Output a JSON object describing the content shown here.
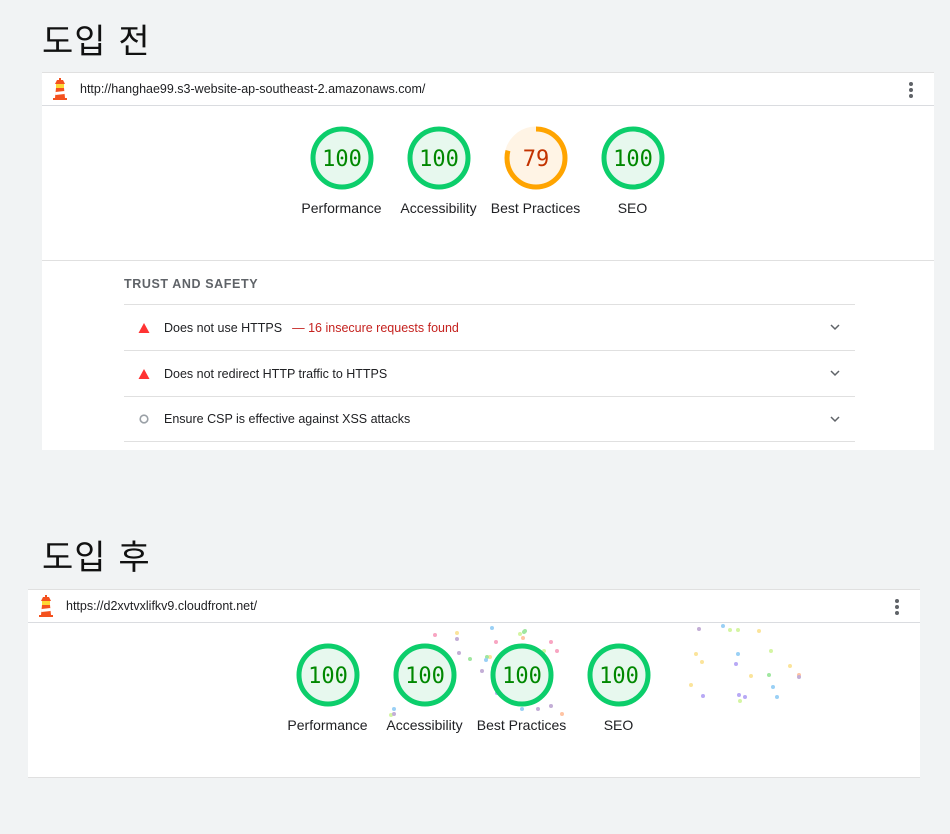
{
  "before": {
    "heading": "도입 전",
    "url": "http://hanghae99.s3-website-ap-southeast-2.amazonaws.com/",
    "gauges": [
      {
        "score": "100",
        "label": "Performance",
        "value": 100,
        "status": "pass"
      },
      {
        "score": "100",
        "label": "Accessibility",
        "value": 100,
        "status": "pass"
      },
      {
        "score": "79",
        "label": "Best Practices",
        "value": 79,
        "status": "average"
      },
      {
        "score": "100",
        "label": "SEO",
        "value": 100,
        "status": "pass"
      }
    ],
    "section_title": "TRUST AND SAFETY",
    "audits": [
      {
        "title": "Does not use HTTPS",
        "extra": "— 16 insecure requests found",
        "icon": "fail-triangle-icon"
      },
      {
        "title": "Does not redirect HTTP traffic to HTTPS",
        "extra": "",
        "icon": "fail-triangle-icon"
      },
      {
        "title": "Ensure CSP is effective against XSS attacks",
        "extra": "",
        "icon": "informative-circle-icon"
      }
    ]
  },
  "after": {
    "heading": "도입 후",
    "url": "https://d2xvtvxlifkv9.cloudfront.net/",
    "gauges": [
      {
        "score": "100",
        "label": "Performance",
        "value": 100,
        "status": "pass"
      },
      {
        "score": "100",
        "label": "Accessibility",
        "value": 100,
        "status": "pass"
      },
      {
        "score": "100",
        "label": "Best Practices",
        "value": 100,
        "status": "pass"
      },
      {
        "score": "100",
        "label": "SEO",
        "value": 100,
        "status": "pass"
      }
    ]
  },
  "colors": {
    "pass": "#0cce6b",
    "pass_fill": "#e7f8ee",
    "pass_text": "#008800",
    "average": "#ffa400",
    "average_fill": "#fff4e5",
    "average_text": "#c33300",
    "fail": "#ff3333",
    "accent_red_text": "#c5221f"
  },
  "icons": {
    "logo": "lighthouse-icon",
    "menu": "more-vert-icon",
    "expand": "chevron-down-icon"
  }
}
